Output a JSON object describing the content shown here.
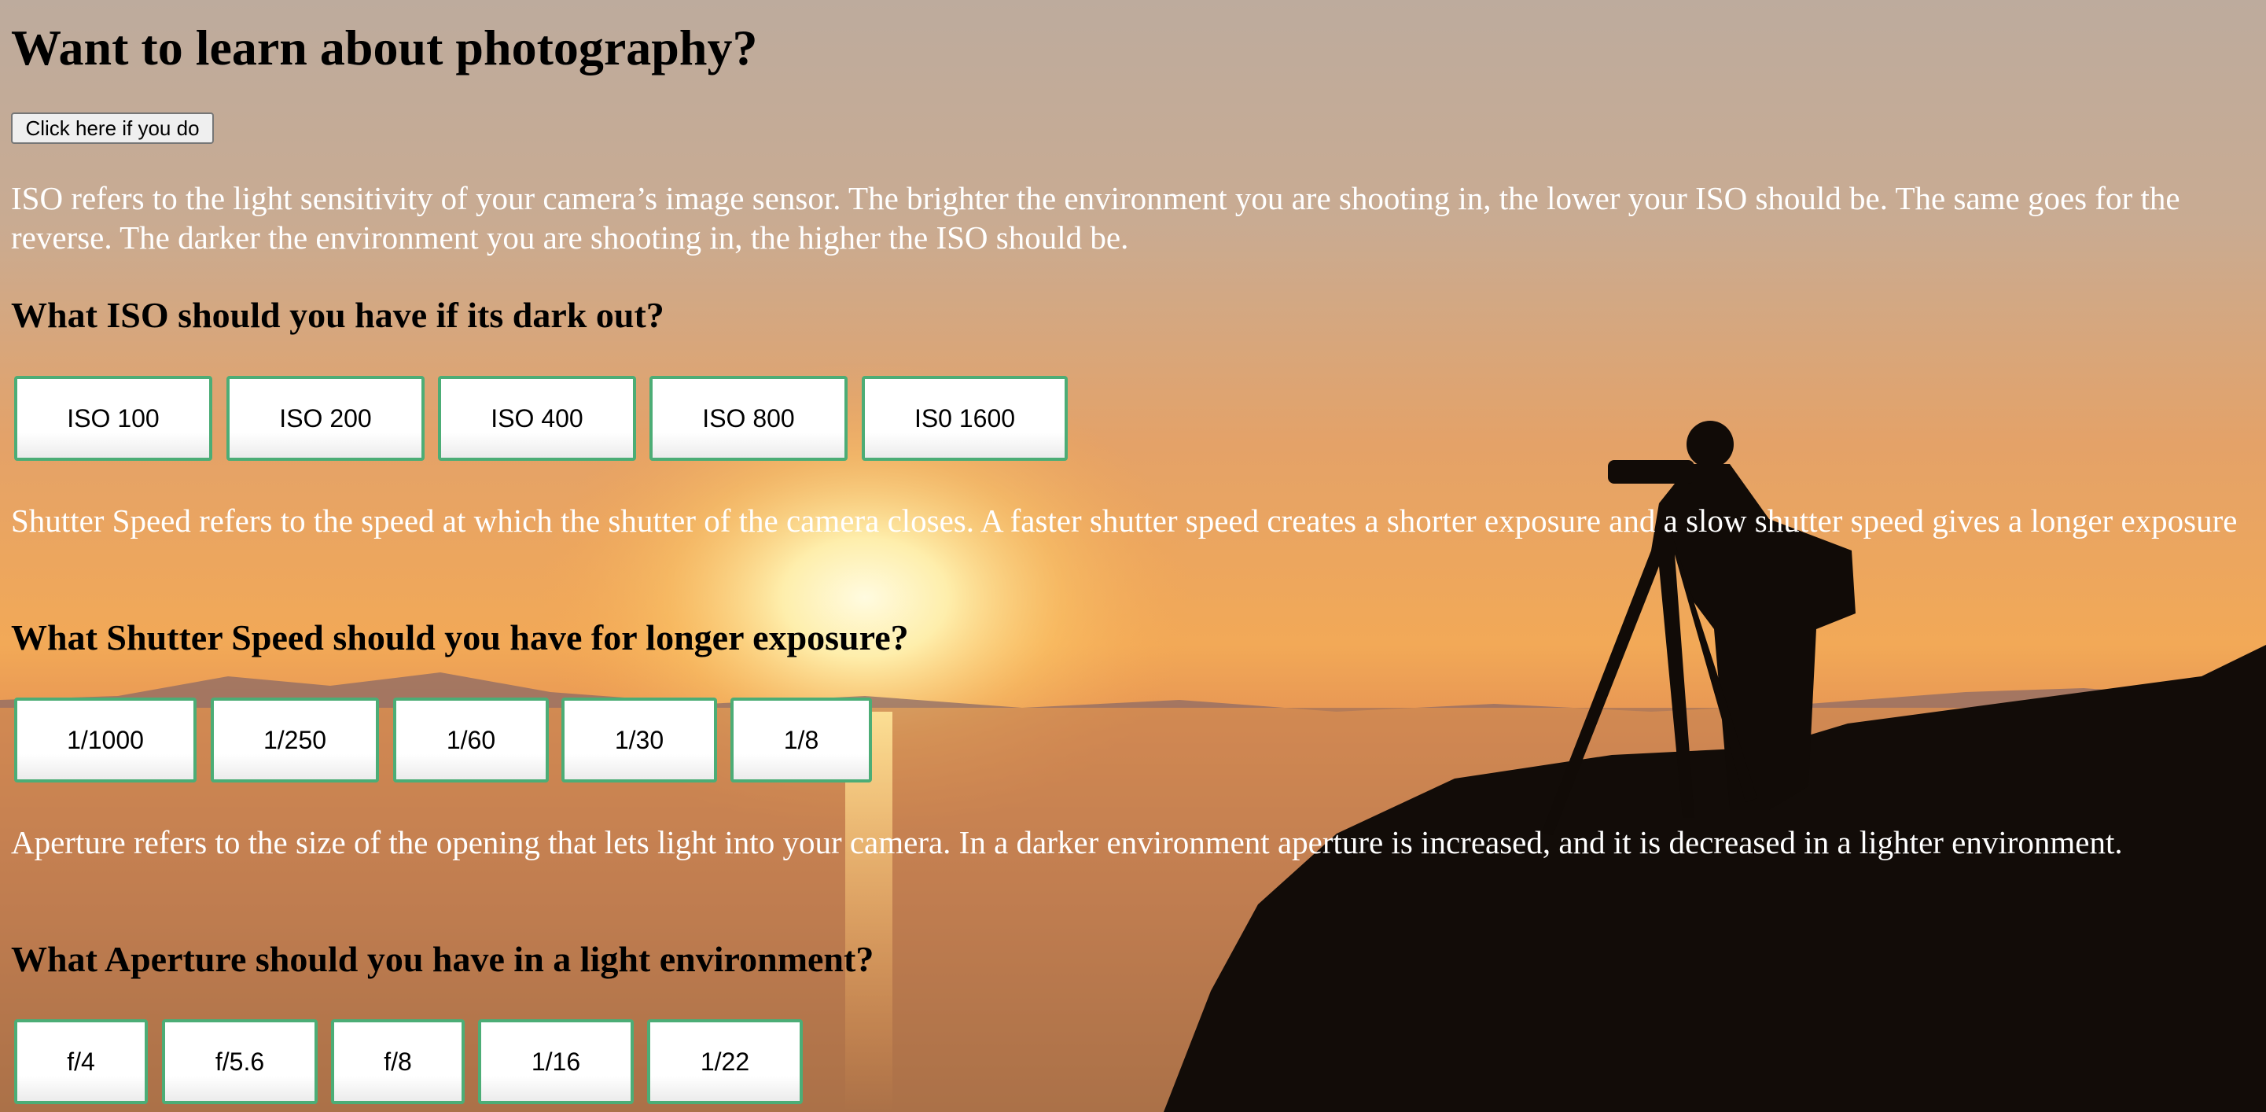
{
  "page": {
    "title": "Want to learn about photography?",
    "cta_button": "Click here if you do"
  },
  "sections": [
    {
      "description": "ISO refers to the light sensitivity of your camera’s image sensor. The brighter the environment you are shooting in, the lower your ISO should be. The same goes for the reverse. The darker the environment you are shooting in, the higher the ISO should be.",
      "question": "What ISO should you have if its dark out?",
      "options": [
        "ISO 100",
        "ISO 200",
        "ISO 400",
        "ISO 800",
        "IS0 1600"
      ]
    },
    {
      "description": "Shutter Speed refers to the speed at which the shutter of the camera closes. A faster shutter speed creates a shorter exposure and a slow shutter speed gives a longer exposure",
      "question": "What Shutter Speed should you have for longer exposure?",
      "options": [
        "1/1000",
        "1/250",
        "1/60",
        "1/30",
        "1/8"
      ]
    },
    {
      "description": "Aperture refers to the size of the opening that lets light into your camera. In a darker environment aperture is increased, and it is decreased in a lighter environment.",
      "question": "What Aperture should you have in a light environment?",
      "options": [
        "f/4",
        "f/5.6",
        "f/8",
        "1/16",
        "1/22"
      ]
    }
  ],
  "background": {
    "subject": "sunset-photographer-silhouette",
    "colors": {
      "sky_top": "#bca99a",
      "sky_mid": "#e8a465",
      "horizon": "#f7b35a",
      "sun": "#fff6c8",
      "sea": "#c68352",
      "silhouette": "#0f0906",
      "option_border": "#4cad76"
    }
  }
}
